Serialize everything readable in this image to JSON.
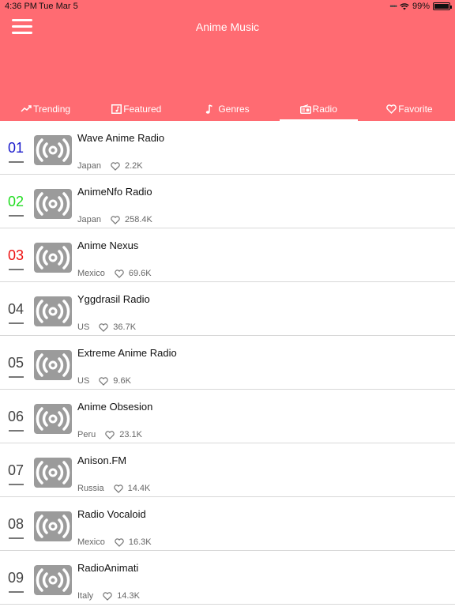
{
  "status_bar": {
    "time": "4:36 PM",
    "date": "Tue Mar 5",
    "battery": "99%"
  },
  "header": {
    "title": "Anime Music",
    "background": "#ff6b72"
  },
  "tabs": [
    {
      "label": "Trending",
      "icon": "trending-icon"
    },
    {
      "label": "Featured",
      "icon": "featured-icon"
    },
    {
      "label": "Genres",
      "icon": "music-note-icon"
    },
    {
      "label": "Radio",
      "icon": "radio-icon",
      "active": true
    },
    {
      "label": "Favorite",
      "icon": "heart-icon"
    }
  ],
  "stations": [
    {
      "rank": "01",
      "rank_color": "#1a1acc",
      "name": "Wave Anime Radio",
      "country": "Japan",
      "likes": "2.2K"
    },
    {
      "rank": "02",
      "rank_color": "#22dd22",
      "name": "AnimeNfo Radio",
      "country": "Japan",
      "likes": "258.4K"
    },
    {
      "rank": "03",
      "rank_color": "#ee1111",
      "name": "Anime Nexus",
      "country": "Mexico",
      "likes": "69.6K"
    },
    {
      "rank": "04",
      "rank_color": "#444444",
      "name": "Yggdrasil Radio",
      "country": "US",
      "likes": "36.7K"
    },
    {
      "rank": "05",
      "rank_color": "#444444",
      "name": "Extreme Anime Radio",
      "country": "US",
      "likes": "9.6K"
    },
    {
      "rank": "06",
      "rank_color": "#444444",
      "name": "Anime Obsesion",
      "country": "Peru",
      "likes": "23.1K"
    },
    {
      "rank": "07",
      "rank_color": "#444444",
      "name": "Anison.FM",
      "country": "Russia",
      "likes": "14.4K"
    },
    {
      "rank": "08",
      "rank_color": "#444444",
      "name": "Radio Vocaloid",
      "country": "Mexico",
      "likes": "16.3K"
    },
    {
      "rank": "09",
      "rank_color": "#444444",
      "name": "RadioAnimati",
      "country": "Italy",
      "likes": "14.3K"
    }
  ]
}
